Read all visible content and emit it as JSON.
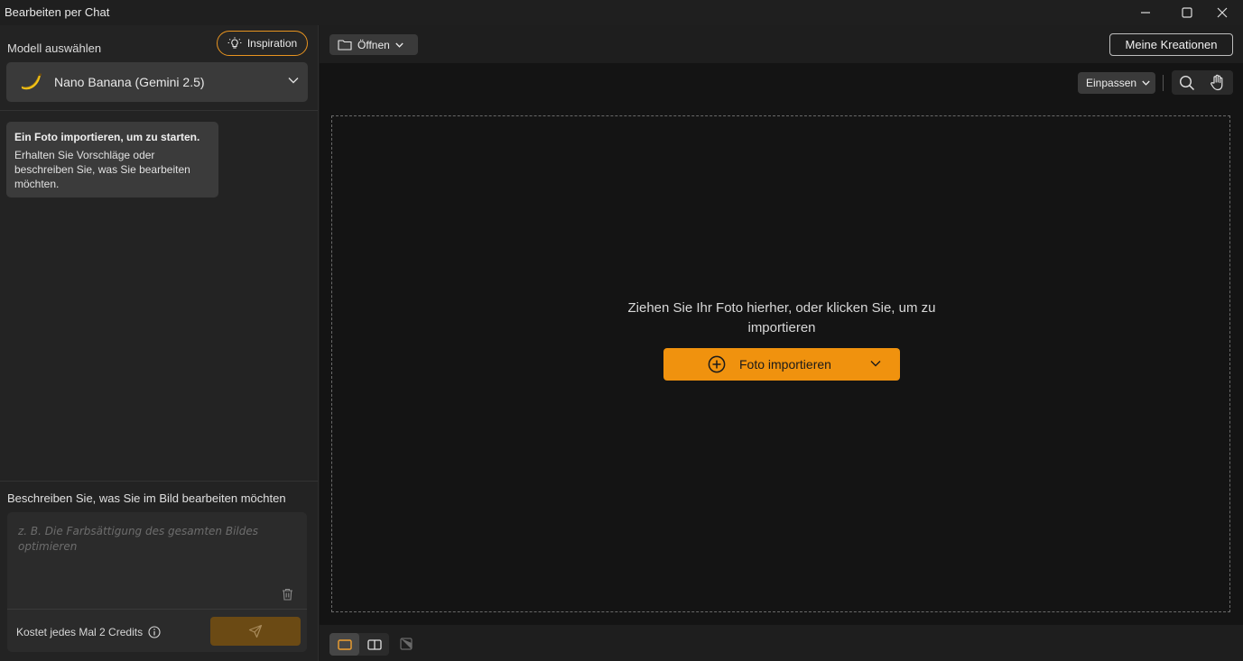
{
  "window": {
    "title": "Bearbeiten per Chat",
    "controls": [
      "minimize-icon",
      "maximize-icon",
      "close-icon"
    ]
  },
  "sidebar": {
    "model_label": "Modell auswählen",
    "inspiration_label": "Inspiration",
    "model_select": {
      "icon": "banana-icon",
      "value": "Nano Banana (Gemini 2.5)"
    },
    "hint": {
      "title": "Ein Foto importieren, um zu starten.",
      "text": "Erhalten Sie Vorschläge oder beschreiben Sie, was Sie bearbeiten möchten."
    },
    "prompt": {
      "label": "Beschreiben Sie, was Sie im Bild bearbeiten möchten",
      "placeholder": "z. B. Die Farbsättigung des gesamten Bildes optimieren",
      "value": "",
      "credits": "Kostet jedes Mal 2 Credits"
    }
  },
  "toolbar": {
    "open_label": "Öffnen",
    "creations_label": "Meine Kreationen",
    "fit_label": "Einpassen"
  },
  "canvas": {
    "drop_text": "Ziehen Sie Ihr Foto hierher, oder klicken Sie, um zu importieren",
    "import_label": "Foto importieren"
  },
  "colors": {
    "accent": "#f0920e",
    "accent_dim": "#6b4a14",
    "panel": "#232323",
    "canvas": "#141414"
  }
}
